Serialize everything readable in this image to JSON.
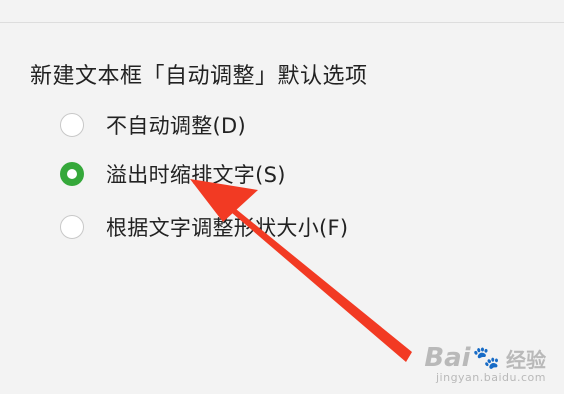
{
  "section": {
    "title": "新建文本框「自动调整」默认选项"
  },
  "options": [
    {
      "label": "不自动调整(D)",
      "checked": false
    },
    {
      "label": "溢出时缩排文字(S)",
      "checked": true
    },
    {
      "label": "根据文字调整形状大小(F)",
      "checked": false
    }
  ],
  "annotation": {
    "arrow_color": "#f23a23",
    "points_to": "溢出时缩排文字(S)"
  },
  "watermark": {
    "brand": "Bai",
    "brand_suffix": "经验",
    "url": "jingyan.baidu.com"
  },
  "colors": {
    "accent": "#35a83a",
    "background": "#f3f3f3"
  }
}
